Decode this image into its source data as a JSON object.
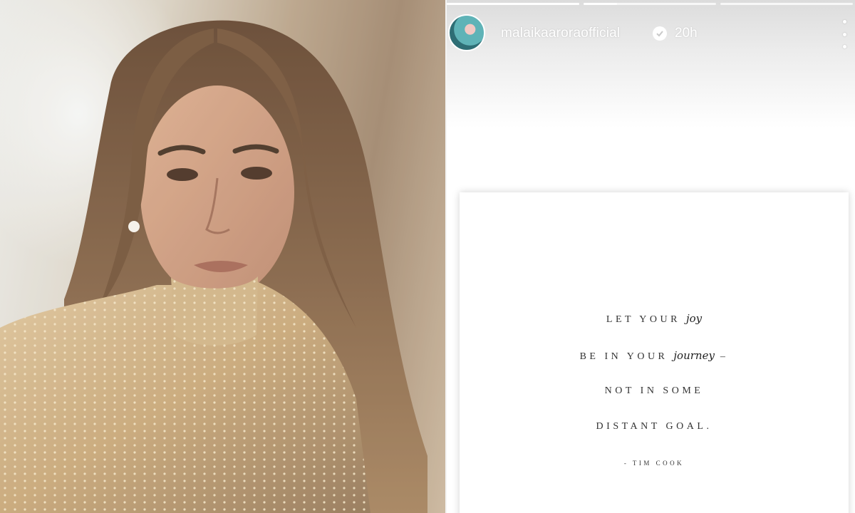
{
  "story": {
    "progress": [
      1,
      0.25,
      0
    ],
    "username": "malaikaaroraofficial",
    "timestamp": "20h",
    "quote": {
      "line1_pre": "LET YOUR",
      "line1_script": "joy",
      "line2_pre": "BE IN YOUR",
      "line2_script": "journey",
      "line2_post": "–",
      "line3": "NOT IN SOME",
      "line4": "DISTANT GOAL.",
      "author": "- TIM COOK"
    }
  },
  "colors": {
    "photo_tone": "#b49f86",
    "dress_gold": "#c9a876",
    "hair": "#6b4a31"
  }
}
